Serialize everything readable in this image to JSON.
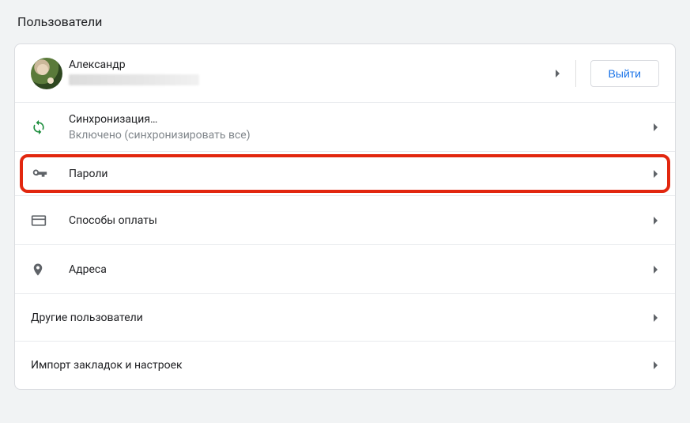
{
  "page": {
    "title": "Пользователи"
  },
  "user": {
    "name": "Александр",
    "signout_label": "Выйти"
  },
  "rows": {
    "sync": {
      "title": "Синхронизация…",
      "subtitle": "Включено (синхронизировать все)"
    },
    "passwords": {
      "title": "Пароли"
    },
    "payment": {
      "title": "Способы оплаты"
    },
    "addresses": {
      "title": "Адреса"
    },
    "other_users": {
      "title": "Другие пользователи"
    },
    "import": {
      "title": "Импорт закладок и настроек"
    }
  }
}
